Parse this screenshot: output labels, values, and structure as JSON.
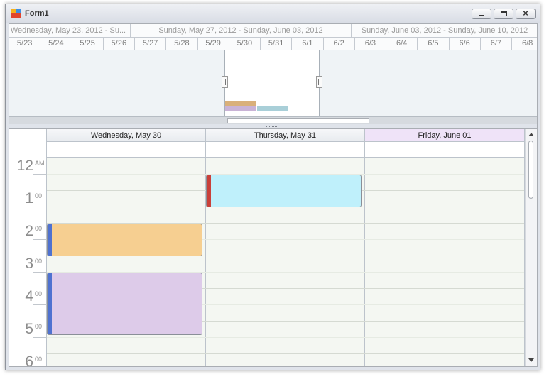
{
  "window": {
    "title": "Form1",
    "icon": "app-form-icon",
    "buttons": [
      {
        "name": "minimize-button",
        "icon": "minimize-icon"
      },
      {
        "name": "maximize-button",
        "icon": "maximize-icon"
      },
      {
        "name": "close-button",
        "icon": "close-icon"
      }
    ]
  },
  "range_control": {
    "ranges": [
      "Wednesday, May 23, 2012 - Su...",
      "Sunday, May 27, 2012 - Sunday, June 03, 2012",
      "Sunday, June 03, 2012 - Sunday, June 10, 2012"
    ],
    "days": [
      "5/23",
      "5/24",
      "5/25",
      "5/26",
      "5/27",
      "5/28",
      "5/29",
      "5/30",
      "5/31",
      "6/1",
      "6/2",
      "6/3",
      "6/4",
      "6/5",
      "6/6",
      "6/7",
      "6/8"
    ],
    "selection": {
      "from": "5/30",
      "to": "6/1"
    },
    "thumbnail_colors": [
      "#d9b07a",
      "#c9b3d6",
      "#a9cfd8"
    ]
  },
  "scheduler": {
    "days": [
      {
        "label": "Wednesday, May 30",
        "today": false
      },
      {
        "label": "Thursday, May 31",
        "today": false
      },
      {
        "label": "Friday, June 01",
        "today": true
      }
    ],
    "time_labels": [
      {
        "hour": "12",
        "suffix": "AM"
      },
      {
        "hour": "1",
        "suffix": "00"
      },
      {
        "hour": "2",
        "suffix": "00"
      },
      {
        "hour": "3",
        "suffix": "00"
      },
      {
        "hour": "4",
        "suffix": "00"
      },
      {
        "hour": "5",
        "suffix": "00"
      },
      {
        "hour": "6",
        "suffix": "00"
      }
    ],
    "appointments": [
      {
        "day": "Thursday, May 31",
        "start": "12:30 AM",
        "end": "1:30 AM",
        "fill": "#bff0fb",
        "status_color": "#c9403a"
      },
      {
        "day": "Wednesday, May 30",
        "start": "2:00 AM",
        "end": "3:00 AM",
        "fill": "#f6cf91",
        "status_color": "#4f72d0"
      },
      {
        "day": "Wednesday, May 30",
        "start": "3:30 AM",
        "end": "5:30 AM",
        "fill": "#ddcbe9",
        "status_color": "#4f72d0"
      }
    ]
  },
  "colors": {
    "today_header": "#efe3f8",
    "work_area": "#f4f7f2"
  }
}
